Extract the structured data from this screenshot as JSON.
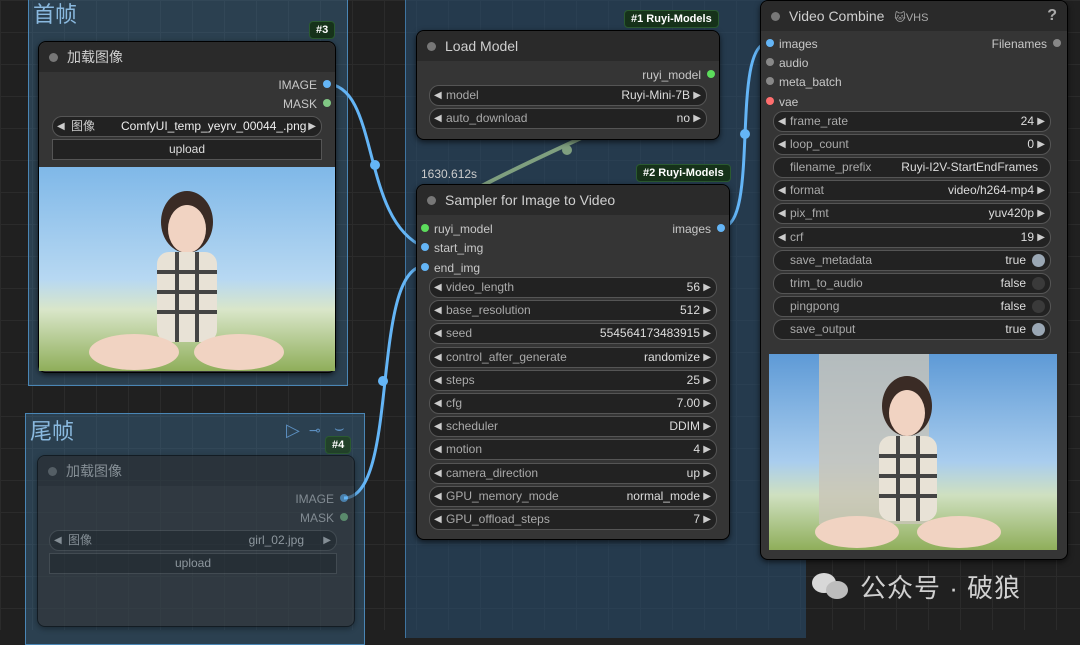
{
  "groups": {
    "first_frame": "首帧",
    "last_frame": "尾帧"
  },
  "badges": {
    "load_image_first": "#3",
    "load_image_last": "#4",
    "load_model": "#1 Ruyi-Models",
    "sampler": "#2 Ruyi-Models"
  },
  "load_image_first": {
    "title": "加载图像",
    "outputs": [
      "IMAGE",
      "MASK"
    ],
    "image_label": "图像",
    "image_value": "ComfyUI_temp_yeyrv_00044_.png",
    "upload": "upload"
  },
  "load_image_last": {
    "title": "加载图像",
    "outputs": [
      "IMAGE",
      "MASK"
    ],
    "image_label": "图像",
    "image_value": "girl_02.jpg",
    "upload": "upload"
  },
  "load_model": {
    "title": "Load Model",
    "output": "ruyi_model",
    "widgets": [
      {
        "label": "model",
        "value": "Ruyi-Mini-7B"
      },
      {
        "label": "auto_download",
        "value": "no"
      }
    ]
  },
  "timer": "1630.612s",
  "sampler": {
    "title": "Sampler for Image to Video",
    "inputs": [
      "ruyi_model",
      "start_img",
      "end_img"
    ],
    "output": "images",
    "widgets": [
      {
        "label": "video_length",
        "value": "56"
      },
      {
        "label": "base_resolution",
        "value": "512"
      },
      {
        "label": "seed",
        "value": "554564173483915"
      },
      {
        "label": "control_after_generate",
        "value": "randomize"
      },
      {
        "label": "steps",
        "value": "25"
      },
      {
        "label": "cfg",
        "value": "7.00"
      },
      {
        "label": "scheduler",
        "value": "DDIM"
      },
      {
        "label": "motion",
        "value": "4"
      },
      {
        "label": "camera_direction",
        "value": "up"
      },
      {
        "label": "GPU_memory_mode",
        "value": "normal_mode"
      },
      {
        "label": "GPU_offload_steps",
        "value": "7"
      }
    ]
  },
  "video_combine": {
    "title": "Video Combine",
    "tags": "🐱VHS",
    "help": "?",
    "inputs": [
      "images",
      "audio",
      "meta_batch",
      "vae"
    ],
    "output": "Filenames",
    "widgets": [
      {
        "label": "frame_rate",
        "value": "24",
        "kind": "num"
      },
      {
        "label": "loop_count",
        "value": "0",
        "kind": "num"
      },
      {
        "label": "filename_prefix",
        "value": "Ruyi-I2V-StartEndFrames",
        "kind": "text"
      },
      {
        "label": "format",
        "value": "video/h264-mp4",
        "kind": "combo"
      },
      {
        "label": "pix_fmt",
        "value": "yuv420p",
        "kind": "combo"
      },
      {
        "label": "crf",
        "value": "19",
        "kind": "num"
      },
      {
        "label": "save_metadata",
        "value": "true",
        "kind": "toggle",
        "on": true
      },
      {
        "label": "trim_to_audio",
        "value": "false",
        "kind": "toggle",
        "on": false
      },
      {
        "label": "pingpong",
        "value": "false",
        "kind": "toggle",
        "on": false
      },
      {
        "label": "save_output",
        "value": "true",
        "kind": "toggle",
        "on": true
      }
    ]
  },
  "watermark": "公众号 · 破狼",
  "colors": {
    "link_image": "#64b5f6",
    "link_model": "#7f9f7f",
    "slot_model": "#5cdc5c",
    "slot_image": "#64b5f6",
    "slot_mask": "#81c784",
    "slot_vae": "#ff6e6e",
    "badge_bg": "#16321a"
  }
}
